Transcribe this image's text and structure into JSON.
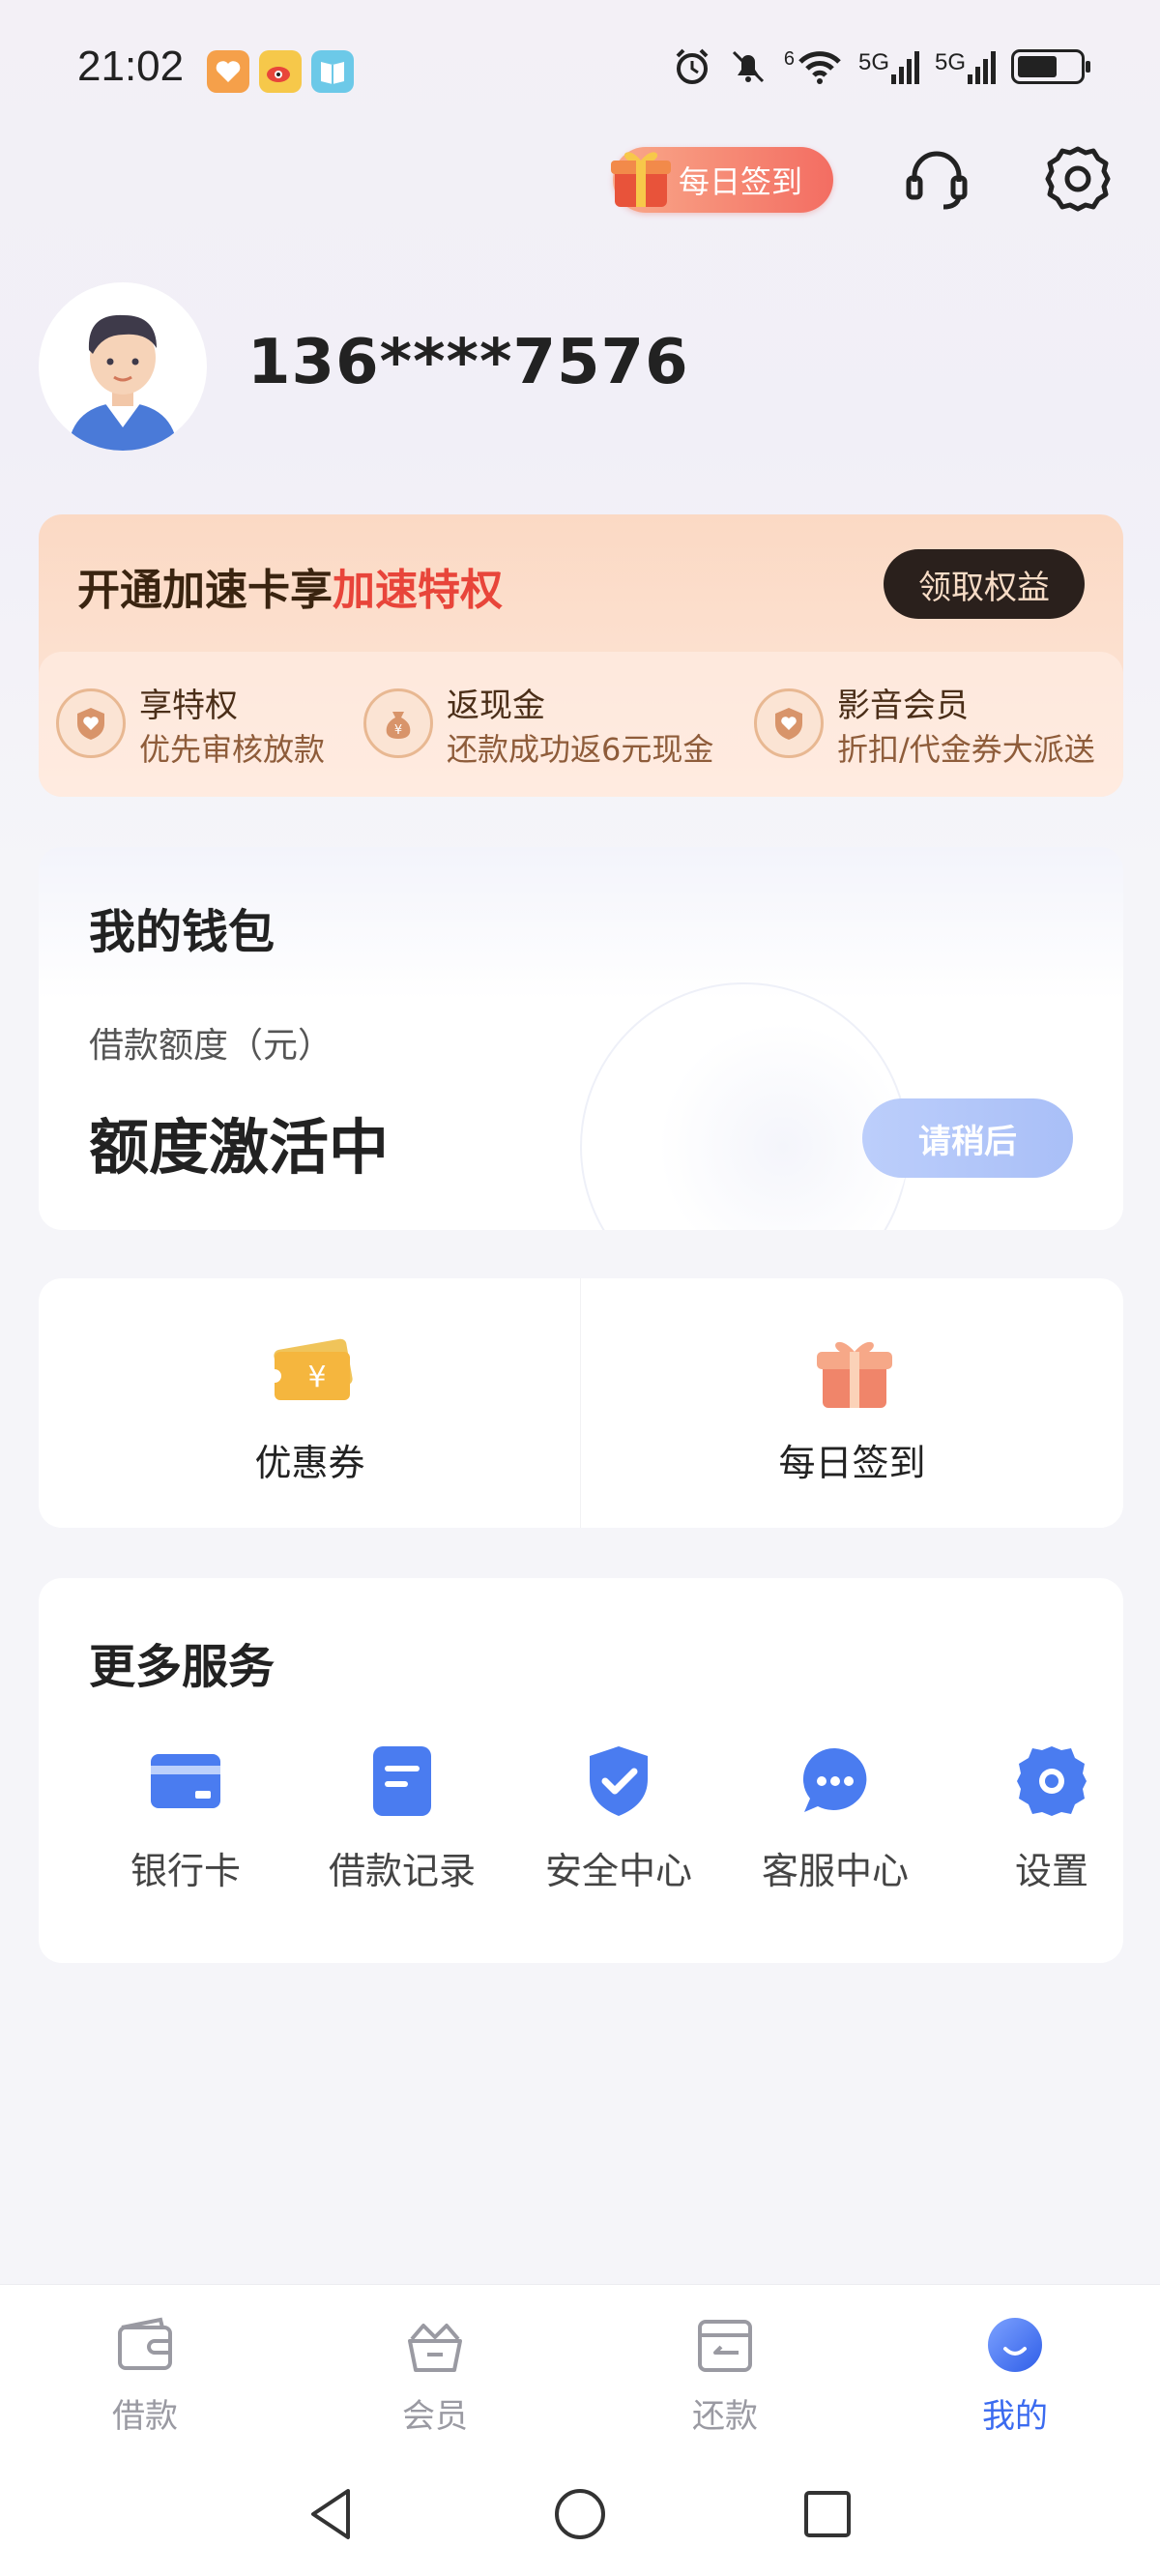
{
  "status_bar": {
    "time": "21:02",
    "network_1": "5G",
    "network_2": "5G",
    "wifi_label": "6"
  },
  "header": {
    "checkin_label": "每日签到",
    "support_icon": "headset-icon",
    "settings_icon": "gear-icon"
  },
  "profile": {
    "phone": "136****7576"
  },
  "vip": {
    "title_prefix": "开通加速卡享",
    "title_highlight": "加速特权",
    "cta": "领取权益",
    "perks": [
      {
        "title": "享特权",
        "subtitle": "优先审核放款",
        "icon": "heart-shield-icon"
      },
      {
        "title": "返现金",
        "subtitle": "还款成功返6元现金",
        "icon": "money-bag-icon"
      },
      {
        "title": "影音会员",
        "subtitle": "折扣/代金券大派送",
        "icon": "heart-shield-icon"
      }
    ],
    "accent": "#e8453a"
  },
  "wallet": {
    "title": "我的钱包",
    "subtitle": "借款额度（元）",
    "status": "额度激活中",
    "button": "请稍后"
  },
  "quick_actions": [
    {
      "label": "优惠券",
      "icon": "coupon-icon"
    },
    {
      "label": "每日签到",
      "icon": "gift-icon"
    }
  ],
  "services": {
    "title": "更多服务",
    "items": [
      {
        "label": "银行卡",
        "icon": "bank-card-icon"
      },
      {
        "label": "借款记录",
        "icon": "record-icon"
      },
      {
        "label": "安全中心",
        "icon": "shield-check-icon"
      },
      {
        "label": "客服中心",
        "icon": "chat-icon"
      },
      {
        "label": "设置",
        "icon": "gear-icon"
      }
    ],
    "icon_color": "#4a7cf0"
  },
  "bottom_nav": [
    {
      "label": "借款",
      "icon": "wallet-icon",
      "active": false
    },
    {
      "label": "会员",
      "icon": "crown-basket-icon",
      "active": false
    },
    {
      "label": "还款",
      "icon": "repay-icon",
      "active": false
    },
    {
      "label": "我的",
      "icon": "me-icon",
      "active": true
    }
  ],
  "active_color": "#3b6bf0"
}
